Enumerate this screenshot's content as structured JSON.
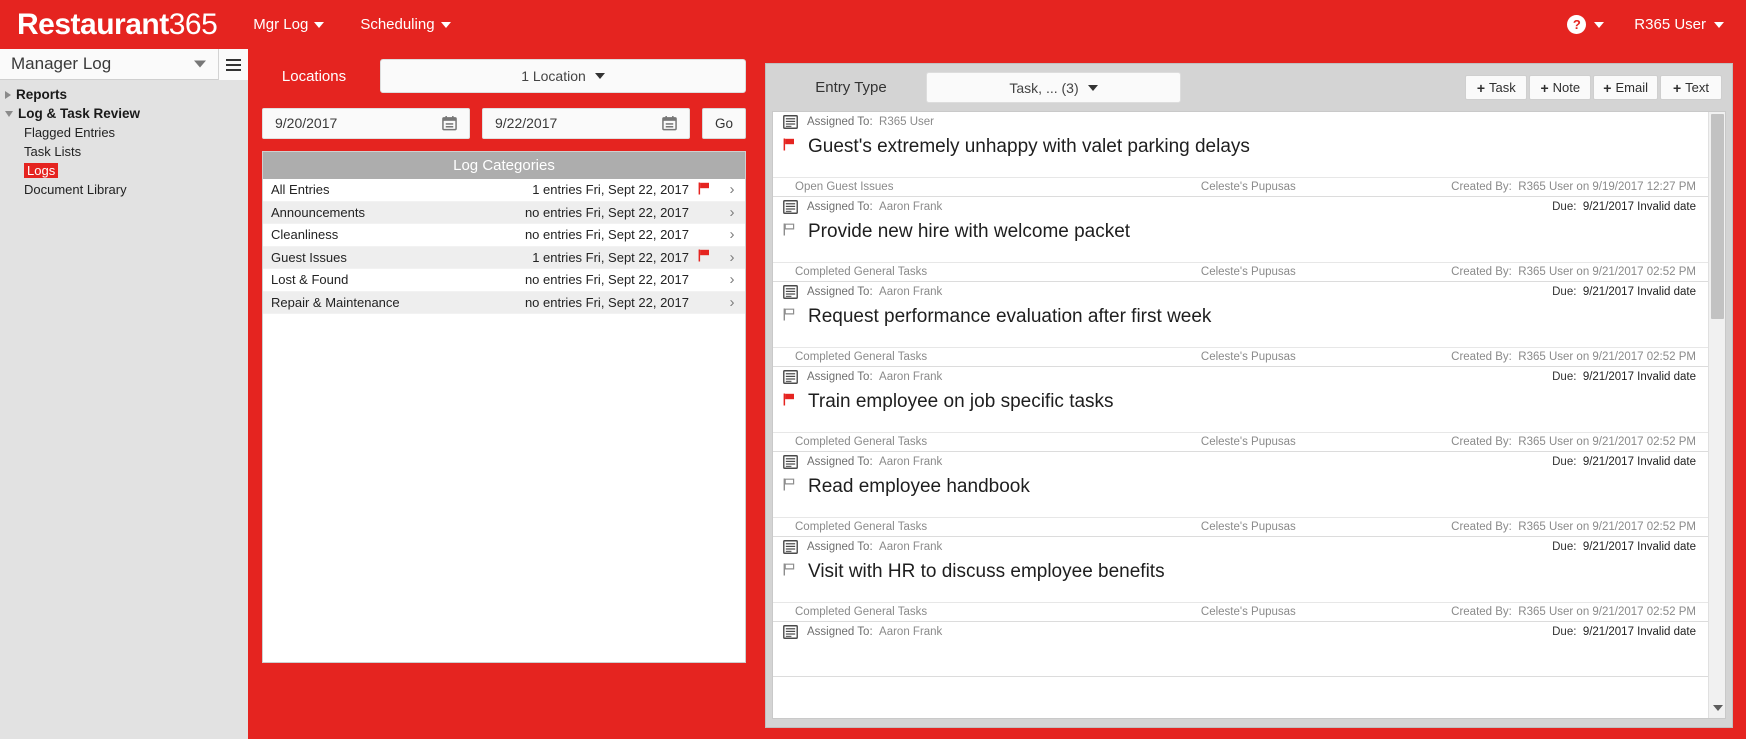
{
  "topnav": {
    "brand_bold": "Restaurant",
    "brand_light": "365",
    "links": [
      {
        "label": "Mgr Log",
        "name": "nav-mgr-log"
      },
      {
        "label": "Scheduling",
        "name": "nav-scheduling"
      }
    ],
    "help_glyph": "?",
    "user_label": "R365 User",
    "brand_color": "#e52420"
  },
  "sidebar": {
    "title": "Manager Log",
    "items": [
      {
        "label": "Reports",
        "level": 1,
        "state": "collapsed",
        "selected": false
      },
      {
        "label": "Log & Task Review",
        "level": 1,
        "state": "expanded",
        "selected": false
      },
      {
        "label": "Flagged Entries",
        "level": 2,
        "state": "leaf",
        "selected": false
      },
      {
        "label": "Task Lists",
        "level": 2,
        "state": "leaf",
        "selected": false
      },
      {
        "label": "Logs",
        "level": 2,
        "state": "leaf",
        "selected": true
      },
      {
        "label": "Document Library",
        "level": 2,
        "state": "leaf",
        "selected": false
      }
    ]
  },
  "center": {
    "locations_label": "Locations",
    "location_value": "1 Location",
    "date_from": "9/20/2017",
    "date_to": "9/22/2017",
    "go_label": "Go",
    "categories_header": "Log Categories",
    "categories": [
      {
        "name": "All Entries",
        "count_text": "1 entries Fri, Sept 22, 2017",
        "flagged": true
      },
      {
        "name": "Announcements",
        "count_text": "no entries Fri, Sept 22, 2017",
        "flagged": false
      },
      {
        "name": "Cleanliness",
        "count_text": "no entries Fri, Sept 22, 2017",
        "flagged": false
      },
      {
        "name": "Guest Issues",
        "count_text": "1 entries Fri, Sept 22, 2017",
        "flagged": true
      },
      {
        "name": "Lost & Found",
        "count_text": "no entries Fri, Sept 22, 2017",
        "flagged": false
      },
      {
        "name": "Repair & Maintenance",
        "count_text": "no entries Fri, Sept 22, 2017",
        "flagged": false
      }
    ]
  },
  "right": {
    "entry_type_label": "Entry Type",
    "entry_type_value": "Task, ... (3)",
    "add_buttons": [
      {
        "label": "Task",
        "name": "add-task-button"
      },
      {
        "label": "Note",
        "name": "add-note-button"
      },
      {
        "label": "Email",
        "name": "add-email-button"
      },
      {
        "label": "Text",
        "name": "add-text-button"
      }
    ],
    "assigned_prefix": "Assigned To:",
    "due_prefix": "Due:",
    "created_prefix": "Created By:",
    "entries": [
      {
        "assigned_to": "R365 User",
        "due": "",
        "flag": "red",
        "title": "Guest's extremely unhappy with valet parking delays",
        "category": "Open Guest Issues",
        "location": "Celeste's Pupusas",
        "created": "R365 User on 9/19/2017 12:27 PM"
      },
      {
        "assigned_to": "Aaron Frank",
        "due": "9/21/2017 Invalid date",
        "flag": "gray",
        "title": "Provide new hire with welcome packet",
        "category": "Completed General Tasks",
        "location": "Celeste's Pupusas",
        "created": "R365 User on 9/21/2017 02:52 PM"
      },
      {
        "assigned_to": "Aaron Frank",
        "due": "9/21/2017 Invalid date",
        "flag": "gray",
        "title": "Request performance evaluation after first week",
        "category": "Completed General Tasks",
        "location": "Celeste's Pupusas",
        "created": "R365 User on 9/21/2017 02:52 PM"
      },
      {
        "assigned_to": "Aaron Frank",
        "due": "9/21/2017 Invalid date",
        "flag": "red",
        "title": "Train employee on job specific tasks",
        "category": "Completed General Tasks",
        "location": "Celeste's Pupusas",
        "created": "R365 User on 9/21/2017 02:52 PM"
      },
      {
        "assigned_to": "Aaron Frank",
        "due": "9/21/2017 Invalid date",
        "flag": "gray",
        "title": "Read employee handbook",
        "category": "Completed General Tasks",
        "location": "Celeste's Pupusas",
        "created": "R365 User on 9/21/2017 02:52 PM"
      },
      {
        "assigned_to": "Aaron Frank",
        "due": "9/21/2017 Invalid date",
        "flag": "gray",
        "title": "Visit with HR to discuss employee benefits",
        "category": "Completed General Tasks",
        "location": "Celeste's Pupusas",
        "created": "R365 User on 9/21/2017 02:52 PM"
      },
      {
        "assigned_to": "Aaron Frank",
        "due": "9/21/2017 Invalid date",
        "flag": "gray",
        "title": "",
        "category": "",
        "location": "",
        "created": ""
      }
    ]
  }
}
